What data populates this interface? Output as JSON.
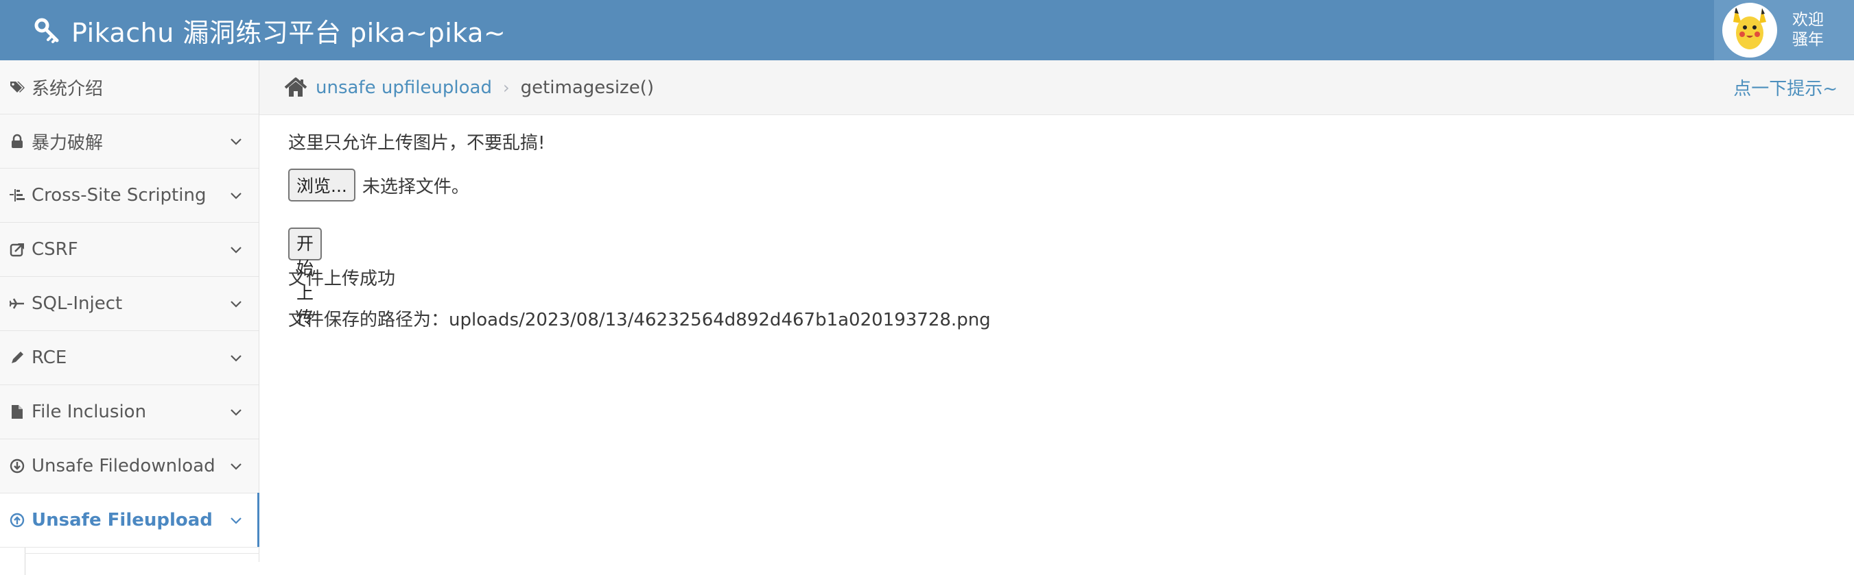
{
  "navbar": {
    "title": "Pikachu 漏洞练习平台 pika~pika~",
    "user_line1": "欢迎",
    "user_line2": "骚年",
    "color": "#578cba"
  },
  "sidebar": {
    "items": [
      {
        "label": "系统介绍",
        "icon": "tags-icon",
        "active": false
      },
      {
        "label": "暴力破解",
        "icon": "lock-icon",
        "active": false
      },
      {
        "label": "Cross-Site Scripting",
        "icon": "list-icon",
        "active": false
      },
      {
        "label": "CSRF",
        "icon": "share-icon",
        "active": false
      },
      {
        "label": "SQL-Inject",
        "icon": "plane-icon",
        "active": false
      },
      {
        "label": "RCE",
        "icon": "pencil-icon",
        "active": false
      },
      {
        "label": "File Inclusion",
        "icon": "file-icon",
        "active": false
      },
      {
        "label": "Unsafe Filedownload",
        "icon": "download-circle-icon",
        "active": false
      },
      {
        "label": "Unsafe Fileupload",
        "icon": "upload-circle-icon",
        "active": true
      }
    ],
    "active_color": "#4b88c2"
  },
  "breadcrumbs": {
    "parent": "unsafe upfileupload",
    "current": "getimagesize()",
    "hint": "点一下提示~"
  },
  "main": {
    "note": "这里只允许上传图片，不要乱搞!",
    "browse_label": "浏览...",
    "file_status": "未选择文件。",
    "upload_label": "开始上传",
    "result": "文件上传成功",
    "path_line": "文件保存的路径为：uploads/2023/08/13/46232564d892d467b1a020193728.png"
  }
}
